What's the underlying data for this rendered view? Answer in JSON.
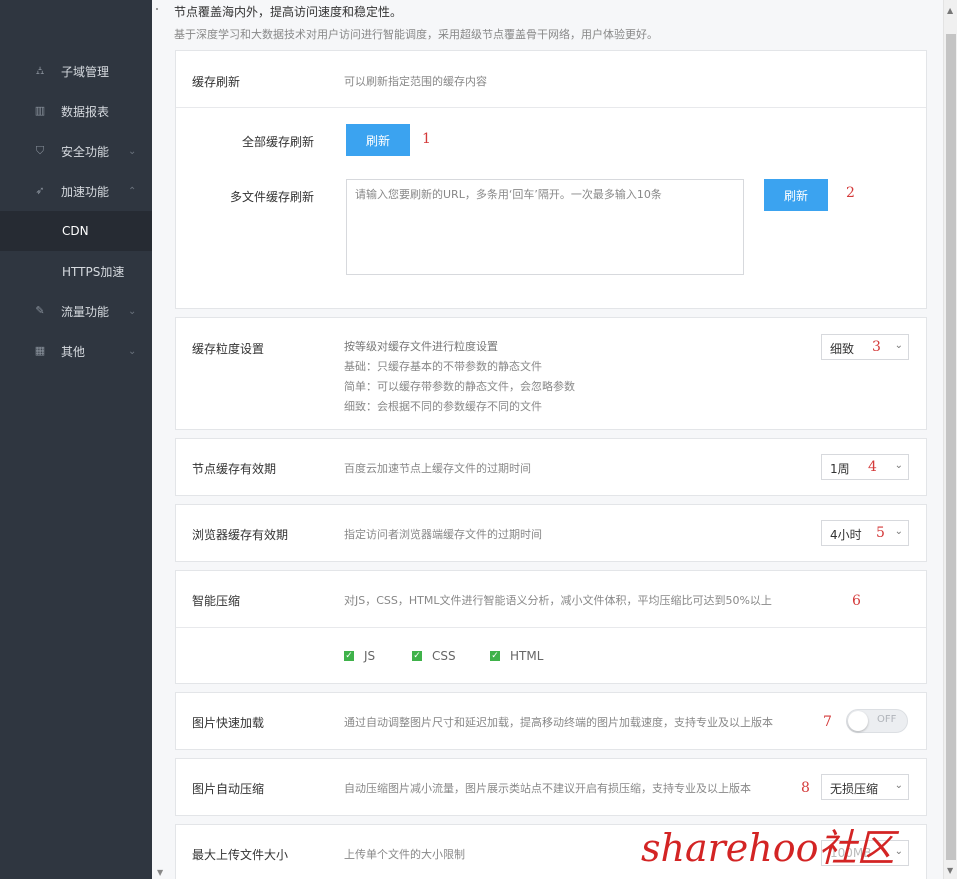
{
  "sidebar": {
    "items": [
      {
        "label": "子域管理",
        "icon": "org-chart-icon",
        "chevron": ""
      },
      {
        "label": "数据报表",
        "icon": "bar-chart-icon",
        "chevron": ""
      },
      {
        "label": "安全功能",
        "icon": "shield-icon",
        "chevron": "⌄"
      },
      {
        "label": "加速功能",
        "icon": "rocket-icon",
        "chevron": "⌃"
      },
      {
        "label": "CDN",
        "icon": "",
        "chevron": ""
      },
      {
        "label": "HTTPS加速",
        "icon": "",
        "chevron": ""
      },
      {
        "label": "流量功能",
        "icon": "edit-icon",
        "chevron": "⌄"
      },
      {
        "label": "其他",
        "icon": "grid-icon",
        "chevron": "⌄"
      }
    ]
  },
  "intro": {
    "line1": "节点覆盖海内外，提高访问速度和稳定性。",
    "line2": "基于深度学习和大数据技术对用户访问进行智能调度，采用超级节点覆盖骨干网络，用户体验更好。"
  },
  "cache_refresh": {
    "title": "缓存刷新",
    "desc": "可以刷新指定范围的缓存内容",
    "all_label": "全部缓存刷新",
    "all_button": "刷新",
    "multi_label": "多文件缓存刷新",
    "multi_placeholder": "请输入您要刷新的URL，多条用‘回车’隔开。一次最多输入10条",
    "multi_button": "刷新"
  },
  "granularity": {
    "title": "缓存粒度设置",
    "desc_lines": [
      "按等级对缓存文件进行粒度设置",
      "基础：只缓存基本的不带参数的静态文件",
      "简单：可以缓存带参数的静态文件，会忽略参数",
      "细致：会根据不同的参数缓存不同的文件"
    ],
    "value": "细致"
  },
  "node_cache": {
    "title": "节点缓存有效期",
    "desc": "百度云加速节点上缓存文件的过期时间",
    "value": "1周"
  },
  "browser_cache": {
    "title": "浏览器缓存有效期",
    "desc": "指定访问者浏览器端缓存文件的过期时间",
    "value": "4小时"
  },
  "compress": {
    "title": "智能压缩",
    "desc": "对JS，CSS，HTML文件进行智能语义分析，减小文件体积，平均压缩比可达到50%以上",
    "options": [
      "JS",
      "CSS",
      "HTML"
    ]
  },
  "image_fast": {
    "title": "图片快速加载",
    "desc": "通过自动调整图片尺寸和延迟加载，提高移动终端的图片加载速度，支持专业及以上版本",
    "toggle": "OFF"
  },
  "image_compress": {
    "title": "图片自动压缩",
    "desc": "自动压缩图片减小流量，图片展示类站点不建议开启有损压缩，支持专业及以上版本",
    "value": "无损压缩"
  },
  "max_upload": {
    "title": "最大上传文件大小",
    "desc": "上传单个文件的大小限制",
    "value": "100MB"
  },
  "annotations": [
    "1",
    "2",
    "3",
    "4",
    "5",
    "6",
    "7",
    "8"
  ],
  "watermark": "sharehoo社区",
  "colors": {
    "accent": "#3ba3f0",
    "sidebar": "#2f3640",
    "annotation": "#d43a3a",
    "check": "#3fb24a"
  }
}
